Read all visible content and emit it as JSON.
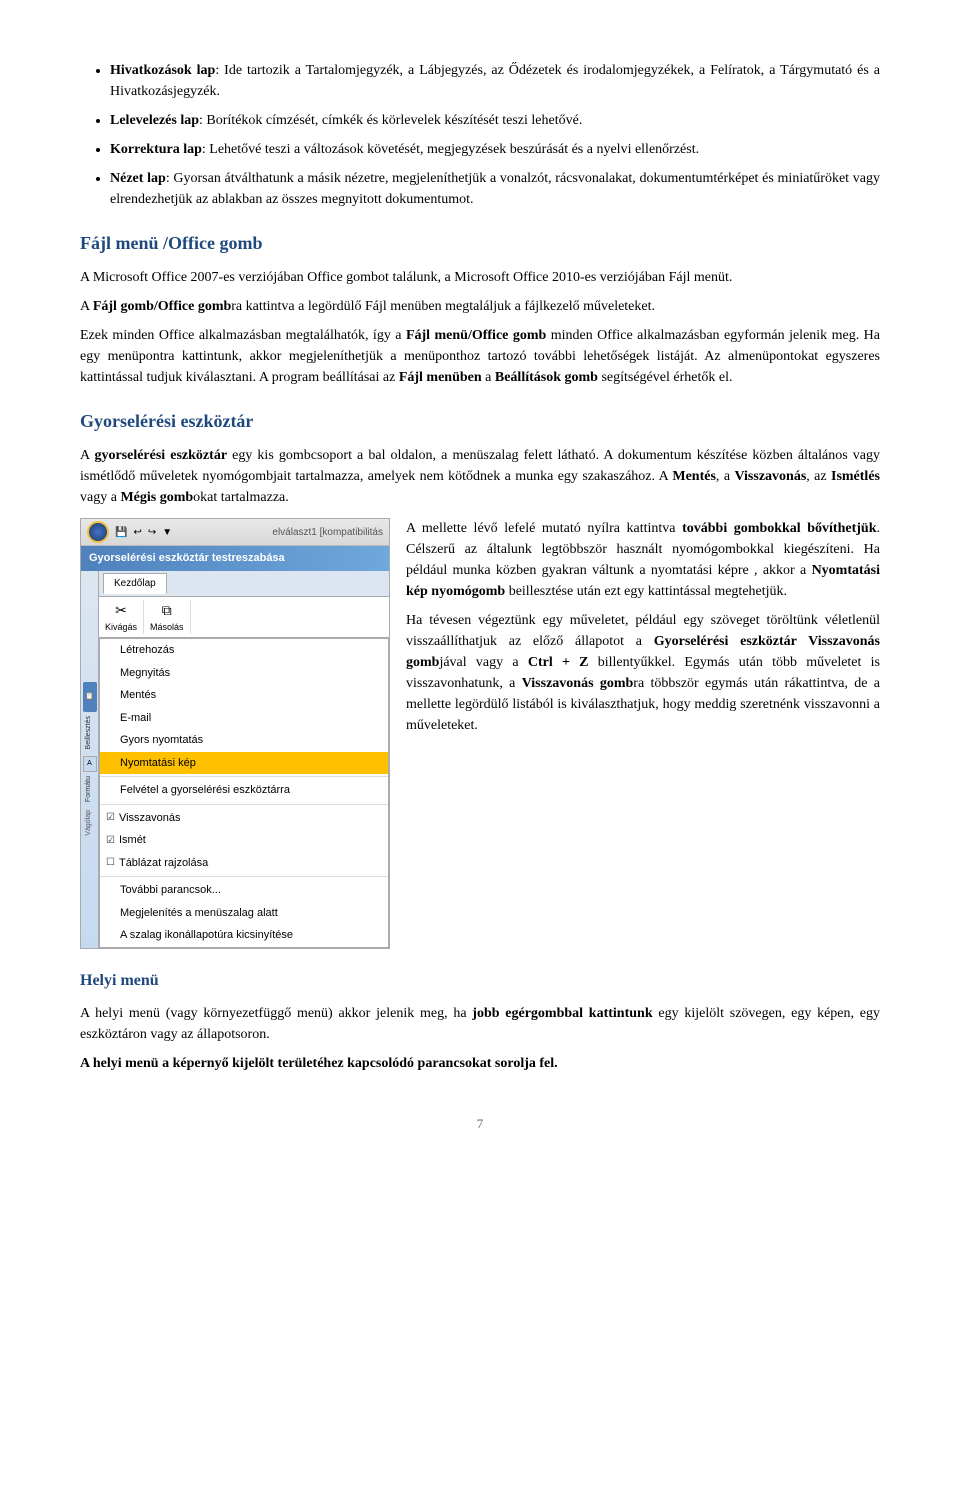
{
  "intro_bullets": [
    {
      "id": "hivatkozasok",
      "text": "Hivatkozások lap",
      "bold_part": "Hivatkozások lap",
      "rest": ": Ide tartozik a Tartalomjegyzék, a Lábjegyzés, az Ődézetek és irodalomjegyzékek, a Felíratok, a Tárgymutató és a Hivatkozásjegyzék."
    },
    {
      "id": "lelevelezés",
      "text": "Lelevelezés lap",
      "bold_part": "Lelevelezés lap",
      "rest": ": Borítékok címzését, címkék és körlevelek készítését teszi lehetővé."
    },
    {
      "id": "korrektura",
      "text": "Korrektura lap",
      "bold_part": "Korrektura lap",
      "rest": ": Lehetővé teszi a változások követését, megjegyzések beszúrását és a nyelvi ellenőrzést."
    },
    {
      "id": "nezet",
      "text": "Nézet lap",
      "bold_part": "Nézet lap",
      "rest": ": Gyorsan átválthatunk a másik nézetre, megjeleníthetjük a vonalzót, rácsvonalakat, dokumentumtérképet és miniatűröket vagy elrendezhetjük az ablakban az összes megnyitott dokumentumot."
    }
  ],
  "section1": {
    "heading": "Fájl menü /Office gomb",
    "para1": "A Microsoft Office 2007-es verziójában Office gombot találunk, a Microsoft Office 2010-es verziójában Fájl menüt.",
    "para2_prefix": "A ",
    "para2_bold": "Fájl gomb/Office gomb",
    "para2_suffix": "ra kattintva a legördülő Fájl menüben megtaláljuk a fájlkezelő műveleteket.",
    "para3_prefix": "Ezek minden Office alkalmazásban megtalálhatók, így a ",
    "para3_bold": "Fájl menü/Office gomb",
    "para3_suffix": " minden Office alkalmazásban egyformán jelenik meg. Ha egy menüpontra kattintunk, akkor megjeleníthetjük a menüponthoz tartozó további lehetőségek listáját. Az almenüpontokat egyszeres kattintással tudjuk kiválasztani. A program beállításai az ",
    "para3_bold2": "Fájl menüben",
    "para3_suffix2": " a ",
    "para3_bold3": "Beállítások gomb",
    "para3_suffix3": " segítségével érhetők el."
  },
  "section2": {
    "heading": "Gyorselérési eszköztár",
    "para1_prefix": "A ",
    "para1_bold": "gyorselérési eszköztár",
    "para1_suffix": " egy kis gombcsoport a bal oldalon, a menüszalag felett látható. A dokumentum készítése közben általános vagy ismétlődő műveletek nyomógombjait tartalmazza, amelyek nem kötődnek a munka egy szakaszához. A ",
    "para1_bold2": "Mentés",
    "para1_suffix2": ", a ",
    "para1_bold3": "Visszavonás",
    "para1_suffix3": ", az ",
    "para1_bold4": "Ismétlés",
    "para1_suffix4": " vagy a ",
    "para1_bold5": "Mégis gomb",
    "para1_suffix5": "okat tartalmazza.",
    "para2_prefix": "A mellette lévő lefelé mutató nyílra kattintva ",
    "para2_bold": "további gombokkal bővíthetjük",
    "para2_suffix": ". Célszerű az általunk legtöbbször használt nyomógombokkal kiegészíteni. Ha például munka közben gyakran váltunk a nyomtatási képre , akkor a ",
    "para2_bold2": "Nyomtatási kép nyomógomb",
    "para2_suffix2": " beillesztése után ezt egy kattintással megtehetjük.",
    "para3": "Ha tévesen végeztünk egy műveletet, például egy szöveget töröltünk véletlenül visszaállíthatjuk az előző állapotot a ",
    "para3_bold": "Gyorselérési eszköztár Visszavonás gomb",
    "para3_suffix": "jával vagy a ",
    "para3_bold2": "Ctrl + Z",
    "para3_suffix2": " billentyűkkel. Egymás után több műveletet is visszavonhatunk, a ",
    "para3_bold3": "Visszavonás gomb",
    "para3_suffix3": "ra többször egymás után rákattintva, de a mellette legördülő listából is kiválaszthatjuk, hogy meddig szeretnénk visszavonni a műveleteket."
  },
  "section3": {
    "heading": "Helyi menü",
    "para1_prefix": "A helyi menü (vagy környezetfüggő menü) akkor jelenik meg, ha ",
    "para1_bold": "jobb egérgombbal kattintunk",
    "para1_suffix": " egy kijelölt szövegen, egy képen, egy eszköztáron vagy az állapotsoron.",
    "para2_bold": "A helyi menü a képernyő kijelölt területéhez kapcsolódó parancsokat sorolja fel."
  },
  "screenshot": {
    "titlebar": "elválaszt1 [kompatibilitás",
    "quick_access_title": "Gyorselérési eszköztár testreszabása",
    "tabs": [
      "Kezdőlap"
    ],
    "ribbon_groups": [
      "Kivágás",
      "Másolás",
      "Beillesztés",
      "Formátu",
      "Vágólap"
    ],
    "menu_items": [
      {
        "label": "Létrehozás",
        "selected": false
      },
      {
        "label": "Megnyitás",
        "selected": false
      },
      {
        "label": "Mentés",
        "selected": false
      },
      {
        "label": "E-mail",
        "selected": false
      },
      {
        "label": "Gyors nyomtatás",
        "selected": false
      },
      {
        "label": "Nyomtatási kép",
        "selected": true
      },
      {
        "divider": true
      },
      {
        "label": "Felvétel a gyorselérési eszköztárra",
        "selected": false
      },
      {
        "divider": true
      },
      {
        "label": "Visszavonás",
        "checked": true
      },
      {
        "label": "Ismét",
        "checked": true
      },
      {
        "label": "Táblázat rajzolása",
        "checked": false
      },
      {
        "divider": true
      },
      {
        "label": "További parancsok...",
        "selected": false
      },
      {
        "label": "Megjelenítés a menüszalag alatt",
        "selected": false
      },
      {
        "label": "A szalag ikonállapotúra kicsinyítése",
        "selected": false
      }
    ]
  },
  "page_number": "7"
}
